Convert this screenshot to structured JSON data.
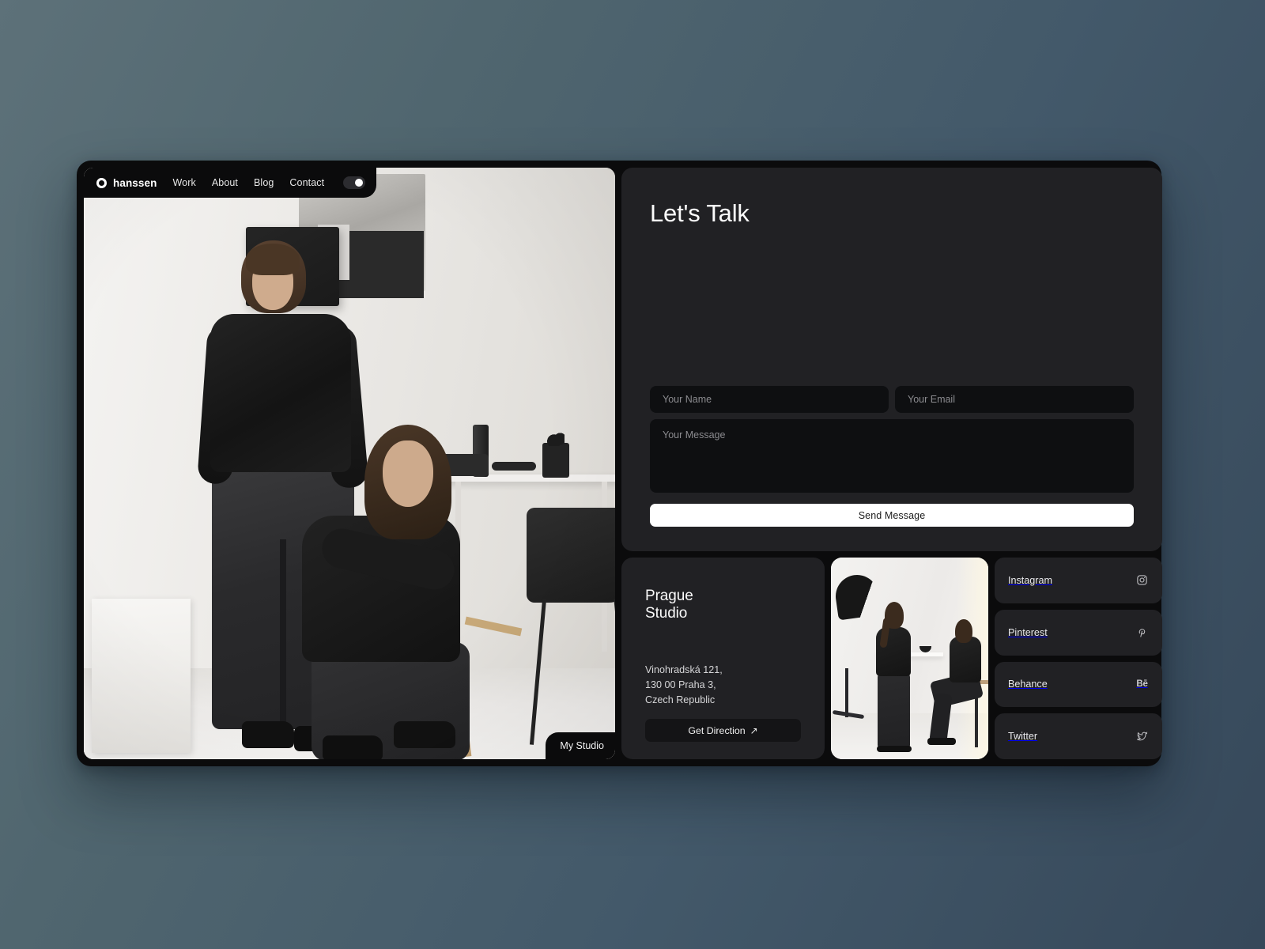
{
  "site": {
    "brand": "hanssen",
    "logo_icon": "ring-logo-icon",
    "nav_links": [
      "Work",
      "About",
      "Blog",
      "Contact"
    ],
    "theme_toggle_state": "on"
  },
  "hero": {
    "badge_label": "My Studio",
    "image_alt": "Two models in black outfits posing in a bright minimal studio"
  },
  "contact_form": {
    "title": "Let's Talk",
    "name_placeholder": "Your Name",
    "name_value": "",
    "email_placeholder": "Your Email",
    "email_value": "",
    "message_placeholder": "Your Message",
    "message_value": "",
    "submit_label": "Send Message"
  },
  "location": {
    "title": "Prague\nStudio",
    "address": "Vinohradská 121,\n130 00 Praha 3,\nCzech Republic",
    "direction_label": "Get Direction",
    "direction_icon": "arrow-up-right-icon",
    "photo_alt": "Two people at a standing table in a photo studio with a black umbrella light"
  },
  "socials": [
    {
      "label": "Instagram",
      "icon": "instagram-icon"
    },
    {
      "label": "Pinterest",
      "icon": "pinterest-icon"
    },
    {
      "label": "Behance",
      "icon": "behance-icon",
      "mark": "Bē"
    },
    {
      "label": "Twitter",
      "icon": "twitter-icon"
    }
  ],
  "colors": {
    "page_gradient_from": "#5d7179",
    "page_gradient_to": "#36485a",
    "window_bg": "#0b0b0c",
    "card_bg": "#212124",
    "input_bg": "#0e0f11",
    "accent_button": "#ffffff",
    "text_primary": "#fbfbfb",
    "text_muted": "#8b8b8f"
  }
}
